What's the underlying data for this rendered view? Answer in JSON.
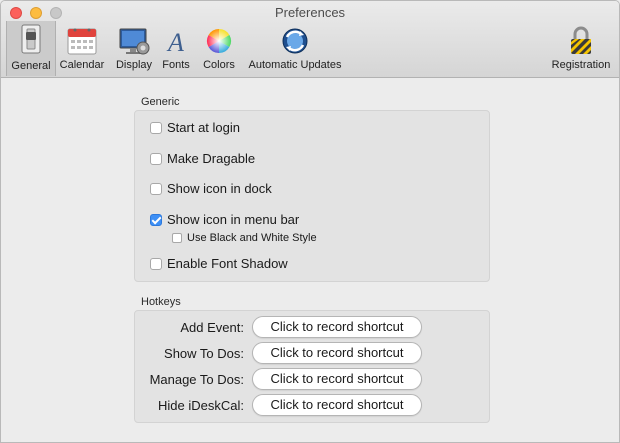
{
  "window": {
    "title": "Preferences"
  },
  "toolbar": {
    "items": [
      {
        "label": "General",
        "icon": "general-switch-icon",
        "selected": true
      },
      {
        "label": "Calendar",
        "icon": "calendar-icon"
      },
      {
        "label": "Display",
        "icon": "display-gear-icon"
      },
      {
        "label": "Fonts",
        "icon": "font-icon"
      },
      {
        "label": "Colors",
        "icon": "color-wheel-icon"
      },
      {
        "label": "Automatic Updates",
        "icon": "sync-globe-icon"
      },
      {
        "label": "Registration",
        "icon": "lock-icon"
      }
    ]
  },
  "generic": {
    "title": "Generic",
    "options": [
      {
        "label": "Start at login",
        "checked": false
      },
      {
        "label": "Make Dragable",
        "checked": false
      },
      {
        "label": "Show icon in dock",
        "checked": false
      },
      {
        "label": "Show icon in menu bar",
        "checked": true
      },
      {
        "label": "Use Black and White Style",
        "checked": false
      },
      {
        "label": "Enable Font Shadow",
        "checked": false
      }
    ]
  },
  "hotkeys": {
    "title": "Hotkeys",
    "rows": [
      {
        "label": "Add Event:",
        "button": "Click to record shortcut"
      },
      {
        "label": "Show To Dos:",
        "button": "Click to record shortcut"
      },
      {
        "label": "Manage To Dos:",
        "button": "Click to record shortcut"
      },
      {
        "label": "Hide iDeskCal:",
        "button": "Click to record shortcut"
      }
    ]
  },
  "colors": {
    "accent": "#3d8ff5",
    "close": "#fc605b",
    "minimize": "#fdbc40"
  }
}
